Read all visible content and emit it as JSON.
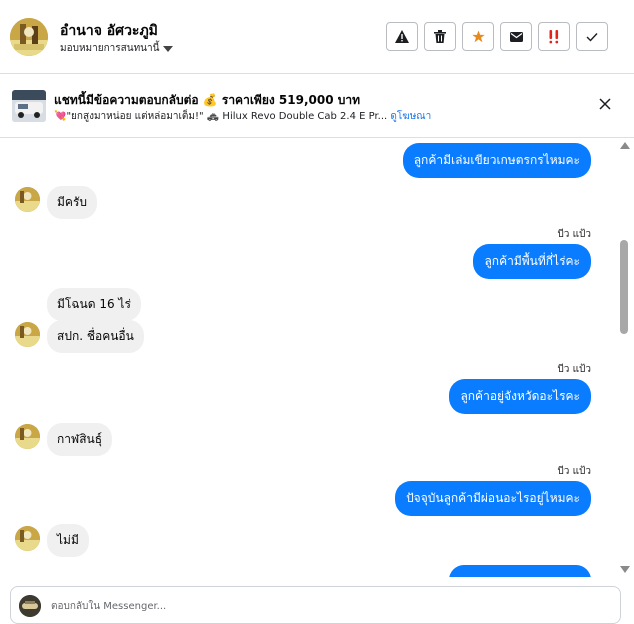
{
  "header": {
    "contact_name": "อำนาจ อัศวะภูมิ",
    "assign_label": "มอบหมายการสนทนานี้",
    "actions": [
      {
        "name": "report-button",
        "icon": "warning-icon"
      },
      {
        "name": "delete-button",
        "icon": "trash-icon"
      },
      {
        "name": "star-button",
        "icon": "star-icon"
      },
      {
        "name": "mark-unread-button",
        "icon": "envelope-icon"
      },
      {
        "name": "important-button",
        "icon": "double-exclamation-icon"
      },
      {
        "name": "done-button",
        "icon": "check-icon"
      }
    ]
  },
  "ad": {
    "title": "แชทนี้มีข้อความตอบกลับต่อ 💰 ราคาเพียง 519,000 บาท",
    "subtitle": "💘\"ยกสูงมาหน่อย แต่หล่อมาเต็ม!\" 🚓 Hilux Revo Double Cab 2.4 E Pr...",
    "link": "ดูโฆษณา"
  },
  "messages": {
    "m1": "ลูกค้ามีเล่มเขียวเกษตรกรไหมคะ",
    "m2": "มีครับ",
    "m3_meta": "บีว แป้ว",
    "m3": "ลูกค้ามีพื้นที่กี่ไร่คะ",
    "m4": "มีโฉนด 16 ไร่",
    "m5": "สปก. ชื่อคนอื่น",
    "m6_meta": "บีว แป้ว",
    "m6": "ลูกค้าอยู่จังหวัดอะไรคะ",
    "m7": "กาฬสินธุ์",
    "m8_meta": "บีว แป้ว",
    "m8": "ปัจจุบันลูกค้ามีผ่อนอะไรอยู่ไหมคะ",
    "m9": "ไม่มี"
  },
  "composer": {
    "placeholder": "ตอบกลับใน Messenger..."
  },
  "colors": {
    "outgoing_bubble": "#0a7cff",
    "incoming_bubble": "#f0f0f0",
    "star": "#e8891c",
    "important": "#e0241b"
  }
}
